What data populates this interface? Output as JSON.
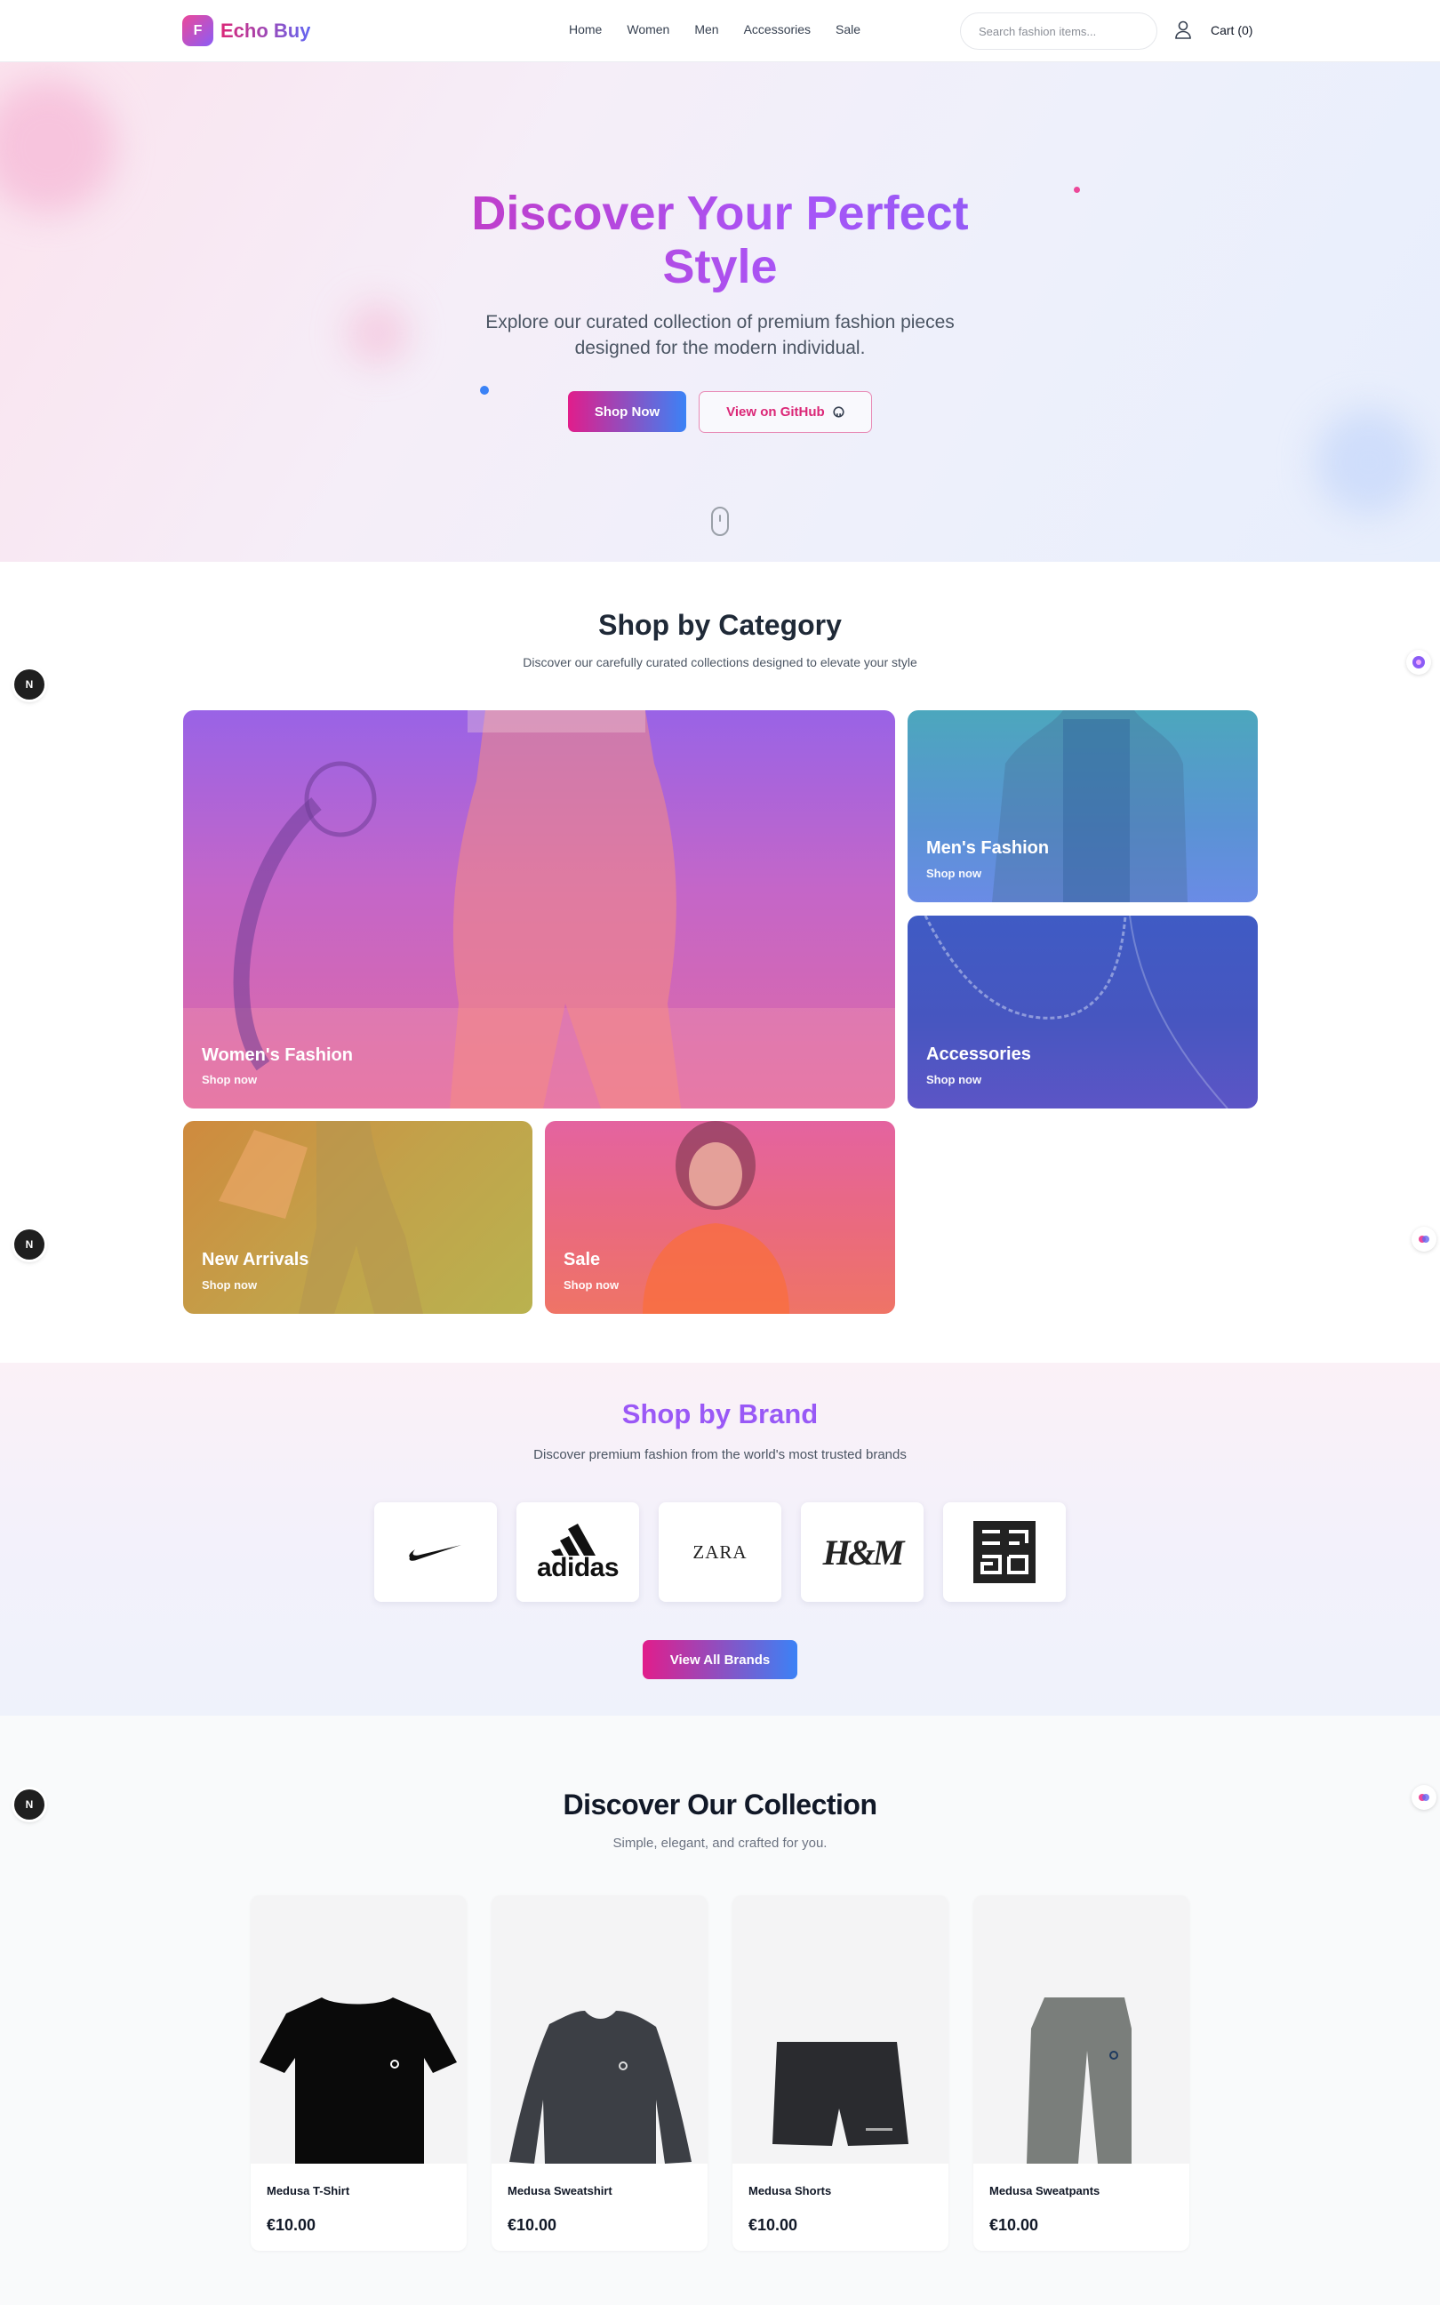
{
  "nav": {
    "logo_letter": "F",
    "logo_text": "Echo Buy",
    "links": [
      "Home",
      "Women",
      "Men",
      "Accessories",
      "Sale"
    ],
    "search_placeholder": "Search fashion items...",
    "cart_label": "Cart (0)"
  },
  "hero": {
    "title_line1": "Discover Your Perfect",
    "title_line2": "Style",
    "subtitle": "Explore our curated collection of premium fashion pieces designed for the modern individual.",
    "primary_button": "Shop Now",
    "secondary_button": "View on GitHub"
  },
  "categories": {
    "title": "Shop by Category",
    "subtitle": "Discover our carefully curated collections designed to elevate your style",
    "items": [
      {
        "title": "Women's Fashion",
        "link": "Shop now"
      },
      {
        "title": "Men's Fashion",
        "link": "Shop now"
      },
      {
        "title": "Accessories",
        "link": "Shop now"
      },
      {
        "title": "New Arrivals",
        "link": "Shop now"
      },
      {
        "title": "Sale",
        "link": "Shop now"
      }
    ]
  },
  "brands": {
    "title": "Shop by Brand",
    "subtitle": "Discover premium fashion from the world's most trusted brands",
    "items": [
      {
        "name": "Nike",
        "logo_text": ""
      },
      {
        "name": "Adidas",
        "logo_text": "adidas"
      },
      {
        "name": "Zara",
        "logo_text": "ZARA"
      },
      {
        "name": "H&M",
        "logo_text": "H&M"
      },
      {
        "name": "Uniqlo",
        "logo_text": ""
      }
    ],
    "button": "View All Brands"
  },
  "collection": {
    "title": "Discover Our Collection",
    "subtitle": "Simple, elegant, and crafted for you.",
    "products": [
      {
        "name": "Medusa T-Shirt",
        "price": "€10.00"
      },
      {
        "name": "Medusa Sweatshirt",
        "price": "€10.00"
      },
      {
        "name": "Medusa Shorts",
        "price": "€10.00"
      },
      {
        "name": "Medusa Sweatpants",
        "price": "€10.00"
      }
    ]
  },
  "side_widget": {
    "letter": "N"
  }
}
